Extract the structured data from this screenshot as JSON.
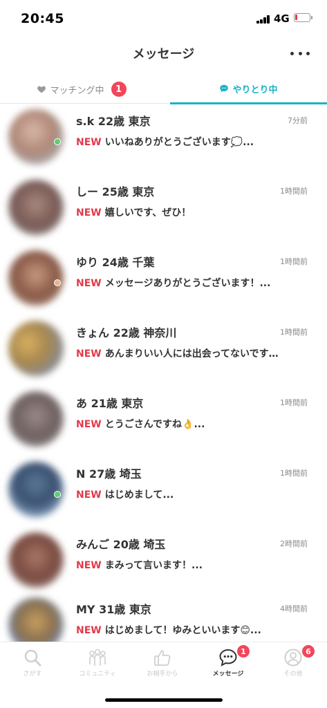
{
  "status": {
    "time": "20:45",
    "network": "4G",
    "battery_level": 0.15,
    "battery_color": "#e53935"
  },
  "header": {
    "title": "メッセージ",
    "more_icon": "more-dots-icon"
  },
  "tabs": {
    "matching": {
      "label": "マッチング中",
      "badge": "1",
      "icon": "heart-icon"
    },
    "chatting": {
      "label": "やりとり中",
      "icon": "chat-bubble-icon",
      "active": true
    }
  },
  "new_label": "NEW",
  "messages": [
    {
      "name": "s.k 22歳 東京",
      "time": "7分前",
      "preview": "いいねありがとうございます💭...",
      "online": true
    },
    {
      "name": "しー 25歳 東京",
      "time": "1時間前",
      "preview": "嬉しいです、ぜひ！",
      "online": false
    },
    {
      "name": "ゆり 24歳 千葉",
      "time": "1時間前",
      "preview": "メッセージありがとうございます！...",
      "online": true
    },
    {
      "name": "きょん 22歳 神奈川",
      "time": "1時間前",
      "preview": "あんまりいい人には出会ってないです…",
      "online": false
    },
    {
      "name": "あ 21歳 東京",
      "time": "1時間前",
      "preview": "とうごさんですね👌...",
      "online": false
    },
    {
      "name": "N 27歳 埼玉",
      "time": "1時間前",
      "preview": "はじめまして...",
      "online": true
    },
    {
      "name": "みんご 20歳 埼玉",
      "time": "2時間前",
      "preview": "まみって言います！...",
      "online": false
    },
    {
      "name": "MY 31歳 東京",
      "time": "4時間前",
      "preview": "はじめまして！ゆみといいます😊...",
      "online": false
    }
  ],
  "nav": {
    "search": {
      "label": "さがす",
      "icon": "search-icon"
    },
    "community": {
      "label": "コミュニティ",
      "icon": "community-icon"
    },
    "likes": {
      "label": "お相手から",
      "icon": "thumbs-up-icon"
    },
    "messages": {
      "label": "メッセージ",
      "icon": "chat-bubble-icon",
      "badge": "1"
    },
    "other": {
      "label": "その他",
      "icon": "profile-icon",
      "badge": "6"
    }
  },
  "colors": {
    "accent": "#18b3c6",
    "badge": "#f2465a",
    "new": "#e23a4a",
    "online": "#56d26c"
  }
}
